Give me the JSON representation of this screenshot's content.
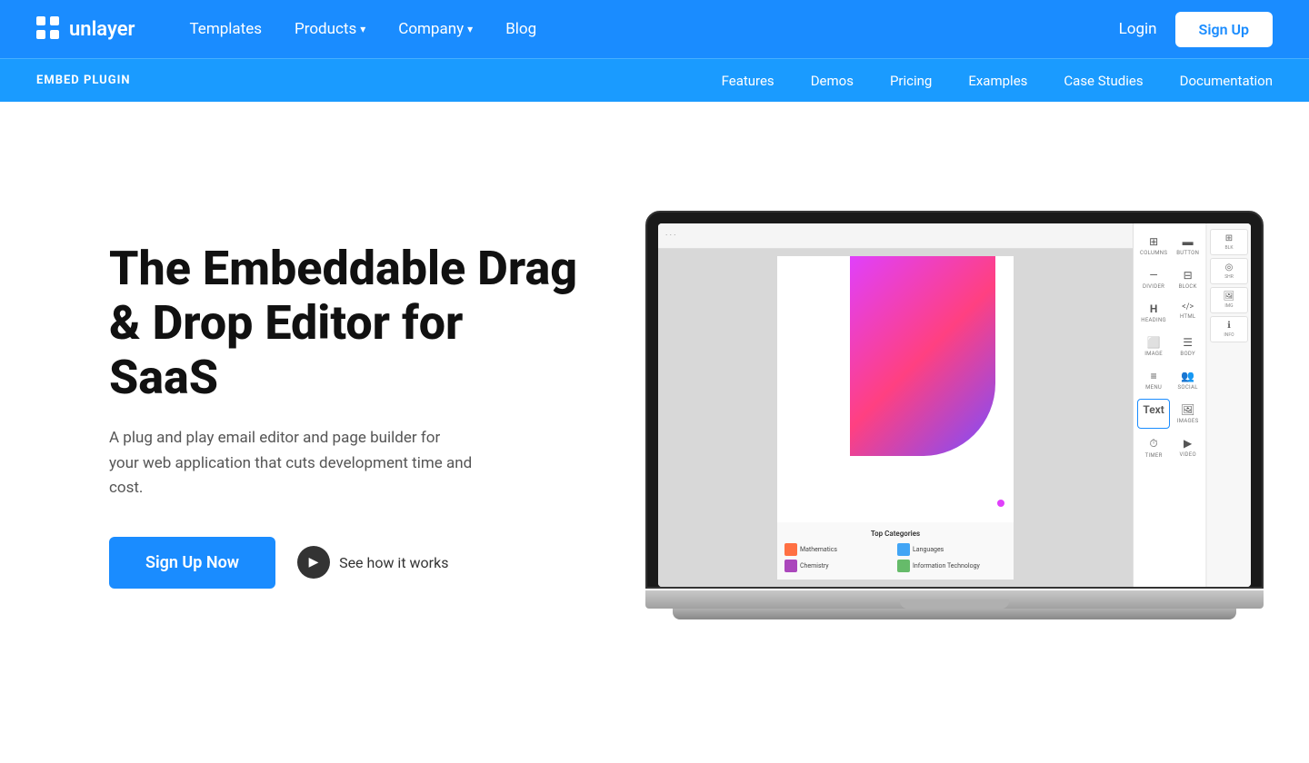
{
  "brand": {
    "name": "unlayer",
    "logo_alt": "unlayer logo"
  },
  "top_nav": {
    "links": [
      {
        "label": "Templates",
        "has_dropdown": false
      },
      {
        "label": "Products",
        "has_dropdown": true
      },
      {
        "label": "Company",
        "has_dropdown": true
      },
      {
        "label": "Blog",
        "has_dropdown": false
      }
    ],
    "login_label": "Login",
    "signup_label": "Sign Up"
  },
  "sub_nav": {
    "section_label": "EMBED PLUGIN",
    "links": [
      {
        "label": "Features"
      },
      {
        "label": "Demos"
      },
      {
        "label": "Pricing"
      },
      {
        "label": "Examples"
      },
      {
        "label": "Case Studies"
      },
      {
        "label": "Documentation"
      }
    ]
  },
  "hero": {
    "title": "The Embeddable Drag & Drop Editor for SaaS",
    "subtitle": "A plug and play email editor and page builder for your web application that cuts development time and cost.",
    "signup_now_label": "Sign Up Now",
    "see_how_label": "See how it works"
  },
  "editor": {
    "tools": [
      {
        "label": "COLUMNS",
        "icon": "⊞"
      },
      {
        "label": "BUTTON",
        "icon": "▬"
      },
      {
        "label": "DIVIDER",
        "icon": "—"
      },
      {
        "label": "BLOCK",
        "icon": "⊟"
      },
      {
        "label": "HEADING",
        "icon": "H"
      },
      {
        "label": "HTML",
        "icon": "</>"
      },
      {
        "label": "IMAGE",
        "icon": "🖼"
      },
      {
        "label": "BODY",
        "icon": "☰"
      },
      {
        "label": "MENU",
        "icon": "≡"
      },
      {
        "label": "SOCIAL",
        "icon": "👥"
      },
      {
        "label": "TEXT",
        "icon": "T",
        "active": true
      },
      {
        "label": "IMAGES",
        "icon": "🖼"
      },
      {
        "label": "TIMER",
        "icon": "⏱"
      },
      {
        "label": "VIDEO",
        "icon": "▶"
      }
    ],
    "canvas": {
      "bottom_card_title": "Top Categories",
      "items": [
        {
          "label": "Mathematics",
          "color": "#ff7043"
        },
        {
          "label": "Languages",
          "color": "#42a5f5"
        },
        {
          "label": "Chemistry",
          "color": "#ab47bc"
        },
        {
          "label": "Information Technology",
          "color": "#66bb6a"
        }
      ]
    }
  }
}
